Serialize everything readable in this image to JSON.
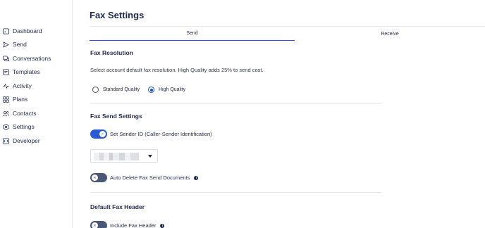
{
  "sidebar": {
    "items": [
      {
        "label": "Dashboard",
        "icon": "dashboard-icon"
      },
      {
        "label": "Send",
        "icon": "send-icon"
      },
      {
        "label": "Conversations",
        "icon": "conversations-icon"
      },
      {
        "label": "Templates",
        "icon": "templates-icon"
      },
      {
        "label": "Activity",
        "icon": "activity-icon"
      },
      {
        "label": "Plans",
        "icon": "plans-icon"
      },
      {
        "label": "Contacts",
        "icon": "contacts-icon"
      },
      {
        "label": "Settings",
        "icon": "settings-icon"
      },
      {
        "label": "Developer",
        "icon": "developer-icon"
      }
    ]
  },
  "page": {
    "title": "Fax Settings"
  },
  "tabs": [
    {
      "label": "Send",
      "active": true
    },
    {
      "label": "Receive",
      "active": false
    }
  ],
  "resolution": {
    "title": "Fax Resolution",
    "description": "Select account default fax resolution. High Quality adds 25% to send cost.",
    "options": [
      {
        "label": "Standard Quality",
        "checked": false
      },
      {
        "label": "High Quality",
        "checked": true
      }
    ]
  },
  "send_settings": {
    "title": "Fax Send Settings",
    "sender_id_label": "Set Sender ID (Caller-Sender Identification)",
    "sender_id_enabled": true,
    "auto_delete_label": "Auto Delete Fax Send Documents",
    "auto_delete_enabled": false,
    "info_glyph": "i"
  },
  "fax_header": {
    "title": "Default Fax Header",
    "include_label": "Include Fax Header",
    "include_enabled": false
  },
  "colors": {
    "accent": "#2a5bd7",
    "text": "#1f2a4d",
    "toggle_off": "#4a5878",
    "border": "#e6e8ee"
  }
}
